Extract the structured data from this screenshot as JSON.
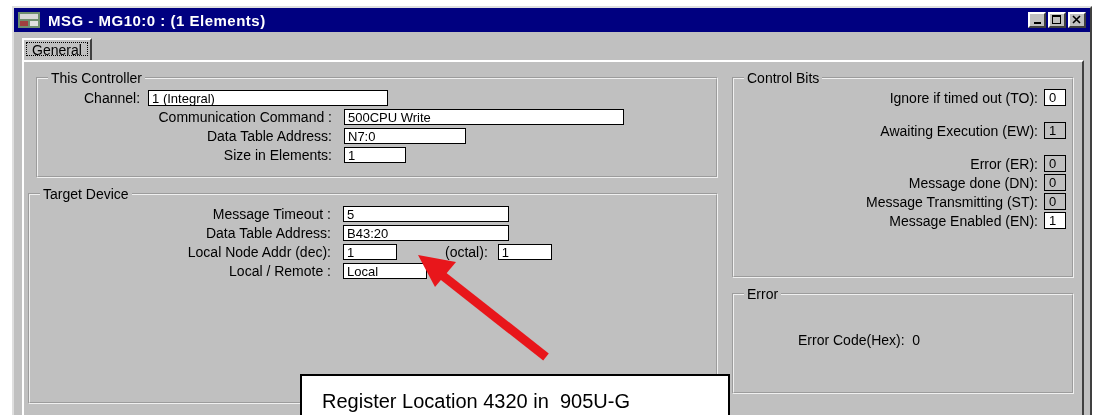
{
  "window": {
    "title": "MSG - MG10:0 : (1 Elements)"
  },
  "tabs": [
    {
      "label": "General",
      "selected": true
    }
  ],
  "this_controller": {
    "title": "This Controller",
    "fields": [
      {
        "label": "Channel:",
        "value": "1 (Integral)"
      },
      {
        "label": "Communication Command :",
        "value": "500CPU Write"
      },
      {
        "label": "Data Table Address:",
        "value": "N7:0"
      },
      {
        "label": "Size in Elements:",
        "value": "1"
      }
    ]
  },
  "target_device": {
    "title": "Target Device",
    "fields": [
      {
        "label": "Message Timeout :",
        "value": "5"
      },
      {
        "label": "Data Table Address:",
        "value": "B43:20"
      },
      {
        "label": "Local Node Addr (dec):",
        "value": "1",
        "extra_label": "(octal):",
        "extra_value": "1"
      },
      {
        "label": "Local / Remote :",
        "value": "Local"
      }
    ]
  },
  "control_bits": {
    "title": "Control Bits",
    "bits": [
      {
        "label": "Ignore if timed out (TO):",
        "value": "0",
        "editable": true
      },
      {
        "label": "Awaiting Execution (EW):",
        "value": "1",
        "editable": false
      },
      {
        "label": "Error (ER):",
        "value": "0",
        "editable": false
      },
      {
        "label": "Message done (DN):",
        "value": "0",
        "editable": false
      },
      {
        "label": "Message Transmitting (ST):",
        "value": "0",
        "editable": false
      },
      {
        "label": "Message Enabled (EN):",
        "value": "1",
        "editable": true
      }
    ]
  },
  "error": {
    "title": "Error",
    "text": "Error Code(Hex):  0"
  },
  "callout": {
    "text": "Register Location 4320 in  905U-G"
  }
}
